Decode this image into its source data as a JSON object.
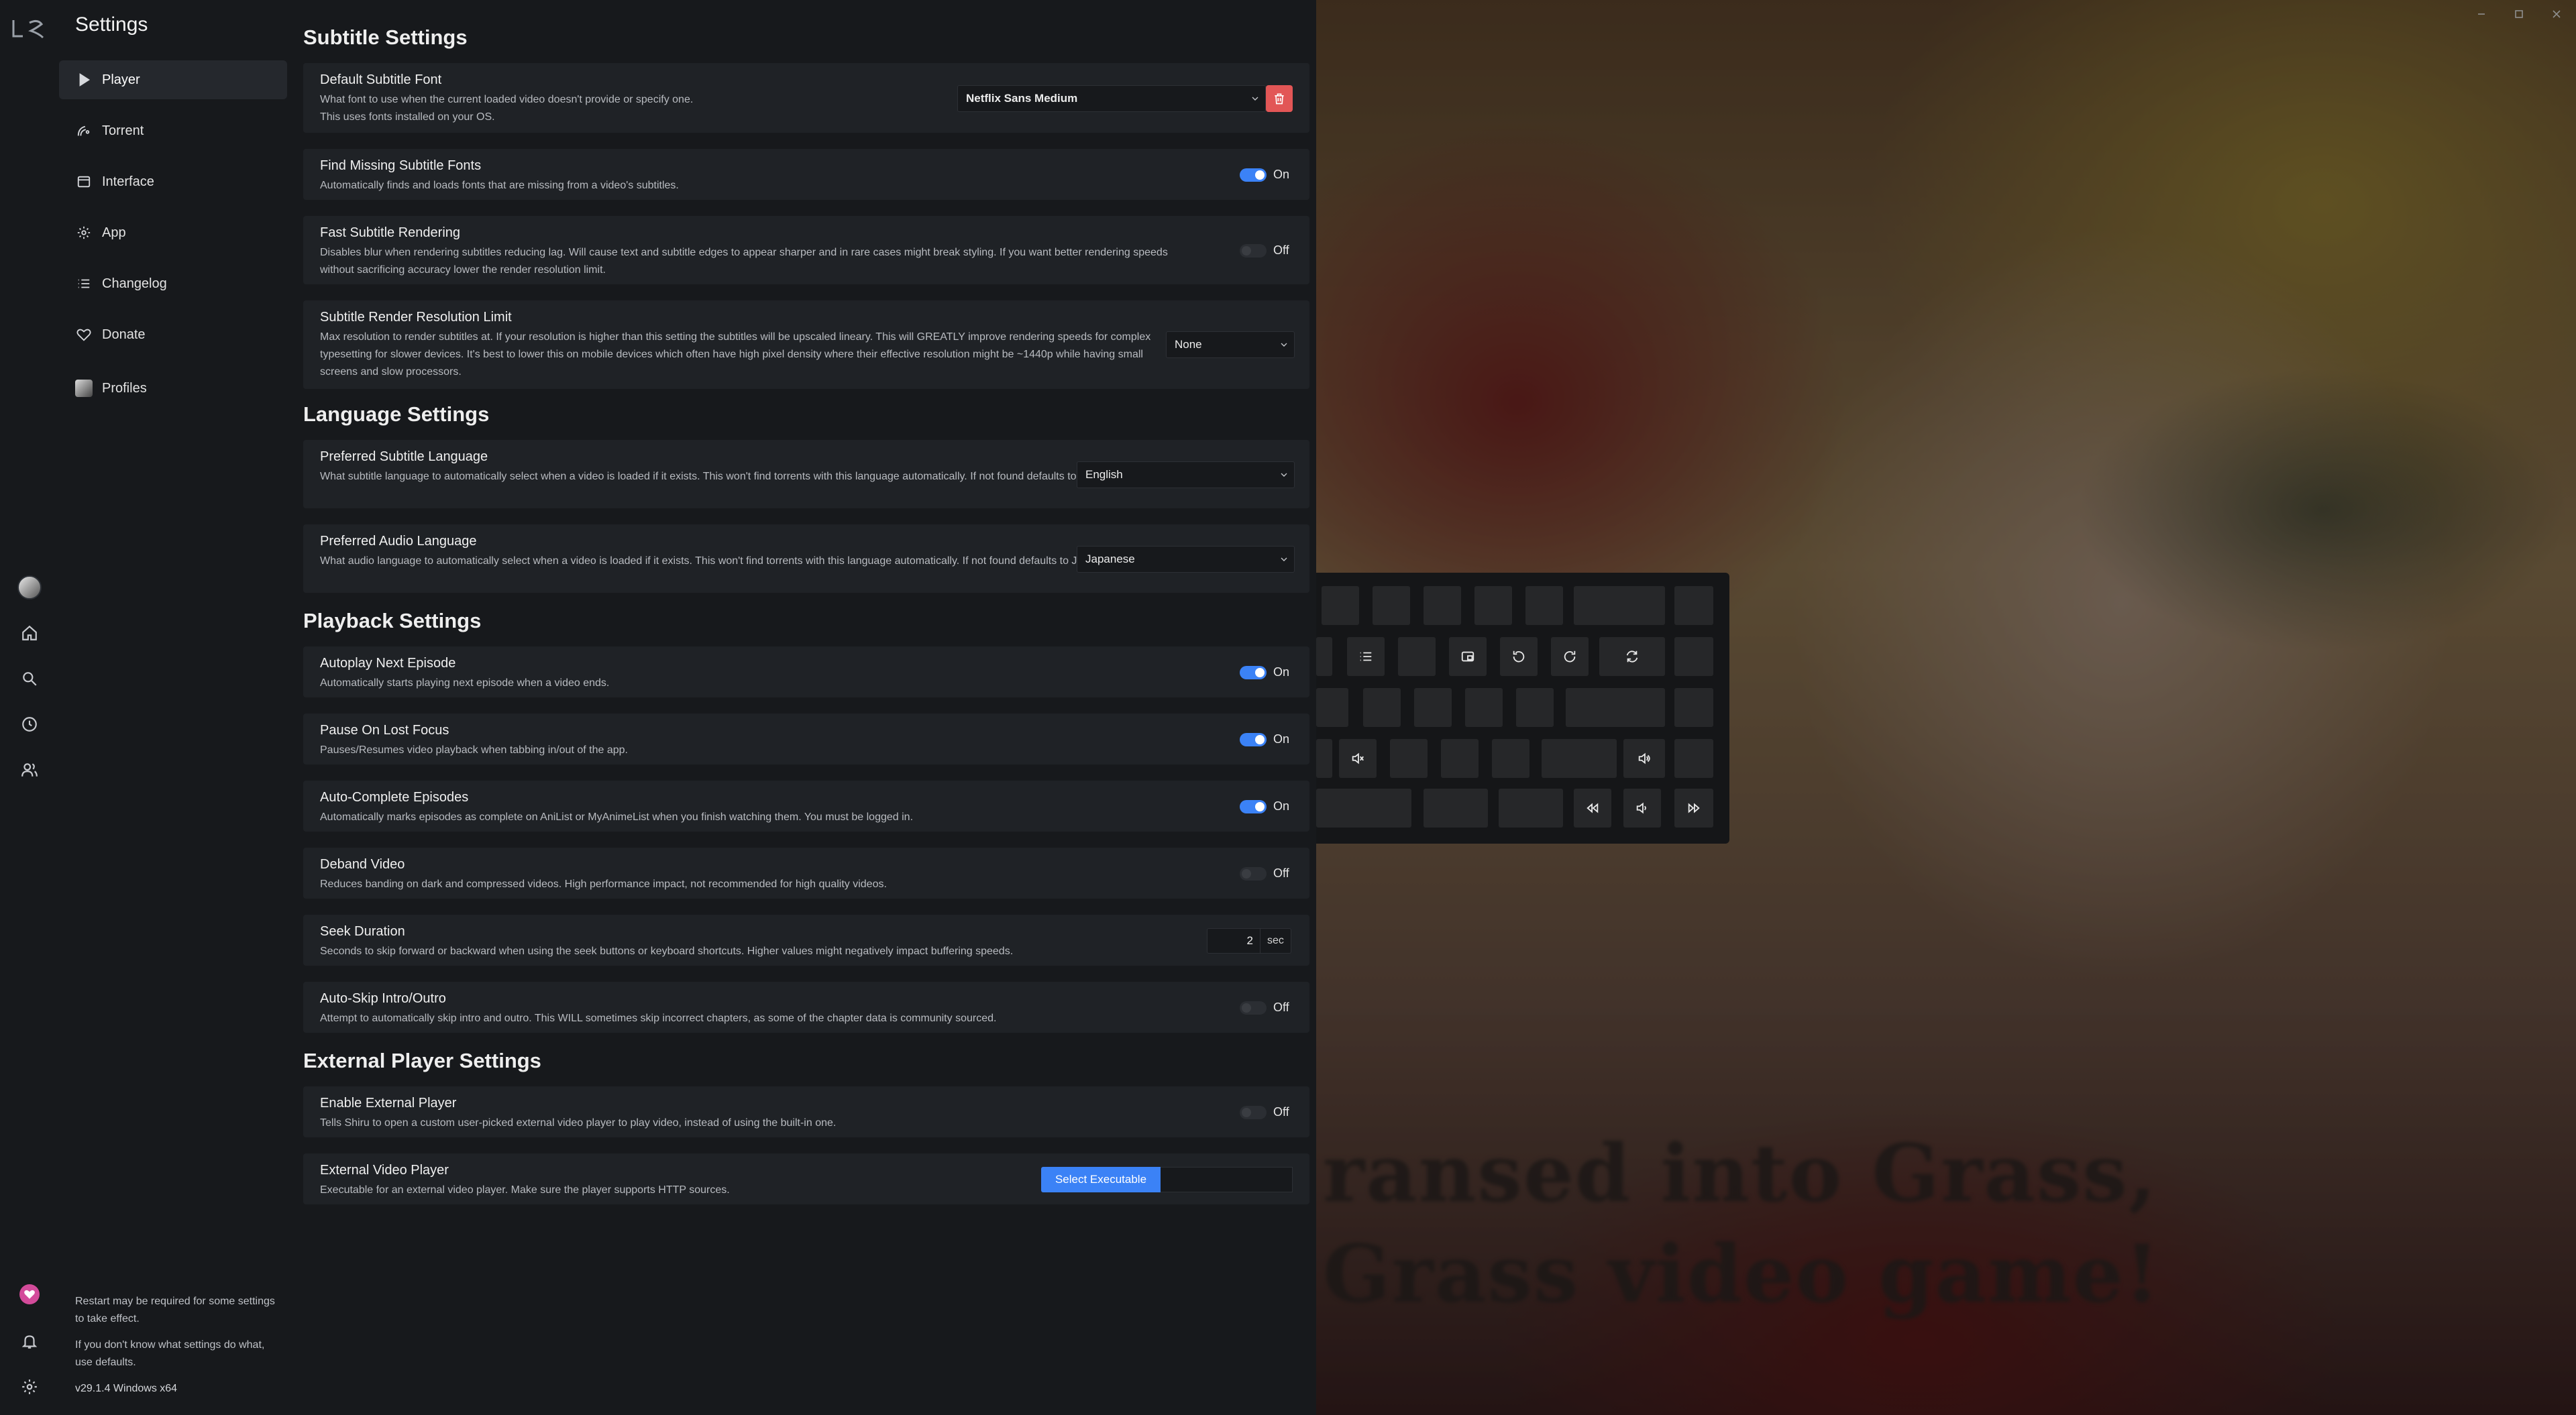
{
  "window": {
    "title": "Settings",
    "controls": [
      "minimize-icon",
      "maximize-icon",
      "close-icon"
    ]
  },
  "rail": {
    "icons": [
      "logo-icon",
      "profile-avatar",
      "home-icon",
      "search-icon",
      "clock-icon",
      "users-icon",
      "heart-icon",
      "bell-icon",
      "gear-icon"
    ]
  },
  "nav": {
    "items": [
      {
        "label": "Player",
        "icon": "play-icon",
        "active": true
      },
      {
        "label": "Torrent",
        "icon": "signal-icon"
      },
      {
        "label": "Interface",
        "icon": "window-icon"
      },
      {
        "label": "App",
        "icon": "gear-icon"
      },
      {
        "label": "Changelog",
        "icon": "list-icon"
      },
      {
        "label": "Donate",
        "icon": "heart-icon"
      },
      {
        "label": "Profiles",
        "icon": "avatar-icon"
      }
    ],
    "footer": {
      "restart_note": "Restart may be required for some settings to take effect.",
      "defaults_note": "If you don't know what settings do what, use defaults.",
      "version": "v29.1.4 Windows x64"
    }
  },
  "sections": {
    "subtitle": {
      "title": "Subtitle Settings",
      "default_font": {
        "label": "Default Subtitle Font",
        "desc1": "What font to use when the current loaded video doesn't provide or specify one.",
        "desc2": "This uses fonts installed on your OS.",
        "value": "Netflix Sans Medium"
      },
      "find_missing": {
        "label": "Find Missing Subtitle Fonts",
        "desc": "Automatically finds and loads fonts that are missing from a video's subtitles.",
        "state": "On"
      },
      "fast_render": {
        "label": "Fast Subtitle Rendering",
        "desc": "Disables blur when rendering subtitles reducing lag. Will cause text and subtitle edges to appear sharper and in rare cases might break styling. If you want better rendering speeds without sacrificing accuracy lower the render resolution limit.",
        "state": "Off"
      },
      "res_limit": {
        "label": "Subtitle Render Resolution Limit",
        "desc": "Max resolution to render subtitles at. If your resolution is higher than this setting the subtitles will be upscaled lineary. This will GREATLY improve rendering speeds for complex typesetting for slower devices. It's best to lower this on mobile devices which often have high pixel density where their effective resolution might be ~1440p while having small screens and slow processors.",
        "value": "None"
      }
    },
    "language": {
      "title": "Language Settings",
      "sub_lang": {
        "label": "Preferred Subtitle Language",
        "desc": "What subtitle language to automatically select when a video is loaded if it exists. This won't find torrents with this language automatically. If not found defaults to English.",
        "value": "English"
      },
      "audio_lang": {
        "label": "Preferred Audio Language",
        "desc": "What audio language to automatically select when a video is loaded if it exists. This won't find torrents with this language automatically. If not found defaults to Japanese.",
        "value": "Japanese"
      }
    },
    "playback": {
      "title": "Playback Settings",
      "autoplay": {
        "label": "Autoplay Next Episode",
        "desc": "Automatically starts playing next episode when a video ends.",
        "state": "On"
      },
      "pause_focus": {
        "label": "Pause On Lost Focus",
        "desc": "Pauses/Resumes video playback when tabbing in/out of the app.",
        "state": "On"
      },
      "auto_complete": {
        "label": "Auto-Complete Episodes",
        "desc": "Automatically marks episodes as complete on AniList or MyAnimeList when you finish watching them. You must be logged in.",
        "state": "On"
      },
      "deband": {
        "label": "Deband Video",
        "desc": "Reduces banding on dark and compressed videos. High performance impact, not recommended for high quality videos.",
        "state": "Off"
      },
      "seek": {
        "label": "Seek Duration",
        "desc": "Seconds to skip forward or backward when using the seek buttons or keyboard shortcuts. Higher values might negatively impact buffering speeds.",
        "value": "2",
        "unit": "sec"
      },
      "auto_skip": {
        "label": "Auto-Skip Intro/Outro",
        "desc": "Attempt to automatically skip intro and outro. This WILL sometimes skip incorrect chapters, as some of the chapter data is community sourced.",
        "state": "Off"
      }
    },
    "external": {
      "title": "External Player Settings",
      "enable": {
        "label": "Enable External Player",
        "desc": "Tells Shiru to open a custom user-picked external video player to play video, instead of using the built-in one.",
        "state": "Off"
      },
      "player": {
        "label": "External Video Player",
        "desc": "Executable for an external video player. Make sure the player supports HTTP sources.",
        "button": "Select Executable"
      }
    }
  },
  "video": {
    "subtitle_line1": "ransed into Grass,",
    "subtitle_line2": "Grass video game!"
  },
  "colors": {
    "accent": "#3b82f6",
    "danger": "#e25656",
    "background": "#17191c",
    "card": "#1f2226"
  }
}
